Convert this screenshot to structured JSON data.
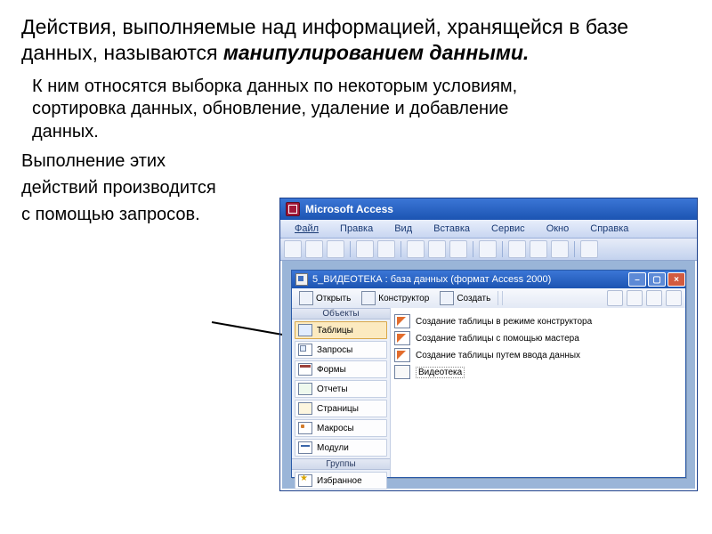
{
  "heading": {
    "line1": "Действия, выполняемые над информацией, хранящейся в базе данных, называются",
    "emph": "манипулированием данными."
  },
  "body": {
    "p1": "К ним относятся выборка данных по некоторым условиям, сортировка данных, обновление, удаление и добавление данных.",
    "p2a": "Выполнение этих",
    "p2b": "действий производится",
    "p2c": "с помощью запросов."
  },
  "access": {
    "app_title": "Microsoft Access",
    "menu": [
      "Файл",
      "Правка",
      "Вид",
      "Вставка",
      "Сервис",
      "Окно",
      "Справка"
    ],
    "db_title": "5_ВИДЕОТЕКА : база данных (формат Access 2000)",
    "db_toolbar": {
      "open": "Открыть",
      "design": "Конструктор",
      "create": "Создать"
    },
    "obj_header": "Объекты",
    "groups_header": "Группы",
    "objects": [
      {
        "key": "tables",
        "label": "Таблицы"
      },
      {
        "key": "queries",
        "label": "Запросы"
      },
      {
        "key": "forms",
        "label": "Формы"
      },
      {
        "key": "reports",
        "label": "Отчеты"
      },
      {
        "key": "pages",
        "label": "Страницы"
      },
      {
        "key": "macros",
        "label": "Макросы"
      },
      {
        "key": "modules",
        "label": "Модули"
      }
    ],
    "favorites": "Избранное",
    "right_items": [
      "Создание таблицы в режиме конструктора",
      "Создание таблицы с помощью мастера",
      "Создание таблицы путем ввода данных",
      "Видеотека"
    ]
  }
}
